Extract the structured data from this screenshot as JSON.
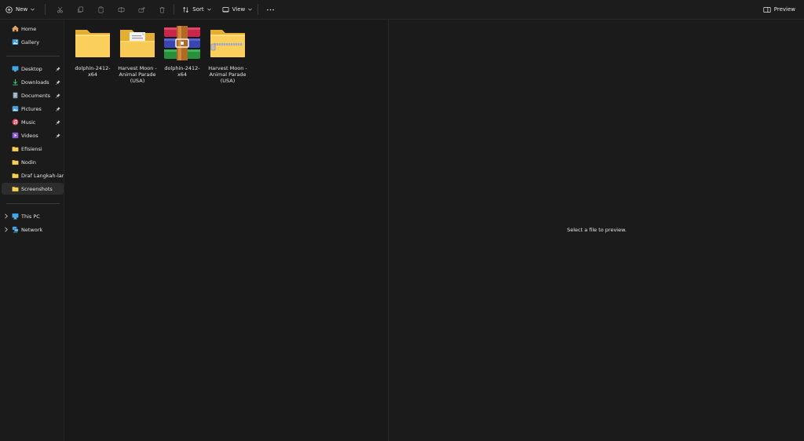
{
  "toolbar": {
    "new_label": "New",
    "sort_label": "Sort",
    "view_label": "View",
    "preview_label": "Preview"
  },
  "sidebar": {
    "items": [
      {
        "label": "Home",
        "icon": "home-icon"
      },
      {
        "label": "Gallery",
        "icon": "gallery-icon"
      },
      {
        "label": "Desktop",
        "icon": "desktop-icon",
        "pinned": true
      },
      {
        "label": "Downloads",
        "icon": "download-icon",
        "pinned": true
      },
      {
        "label": "Documents",
        "icon": "documents-icon",
        "pinned": true
      },
      {
        "label": "Pictures",
        "icon": "pictures-icon",
        "pinned": true
      },
      {
        "label": "Music",
        "icon": "music-icon",
        "pinned": true
      },
      {
        "label": "Videos",
        "icon": "videos-icon",
        "pinned": true
      },
      {
        "label": "Efisiensi",
        "icon": "folder-icon"
      },
      {
        "label": "Nodin",
        "icon": "folder-icon"
      },
      {
        "label": "Draf Langkah-langkah",
        "icon": "folder-icon"
      },
      {
        "label": "Screenshots",
        "icon": "folder-icon",
        "selected": true
      },
      {
        "label": "This PC",
        "icon": "pc-icon"
      },
      {
        "label": "Network",
        "icon": "network-icon"
      }
    ]
  },
  "files": [
    {
      "name": "dolphin-2412-x64",
      "type": "folder"
    },
    {
      "name": "Harvest Moon - Animal Parade (USA)",
      "type": "folder-with-document"
    },
    {
      "name": "dolphin-2412-x64",
      "type": "winrar-archive"
    },
    {
      "name": "Harvest Moon - Animal Parade (USA)",
      "type": "zip-folder"
    }
  ],
  "preview": {
    "message": "Select a file to preview."
  },
  "colors": {
    "background": "#191919",
    "folder_yellow": "#f8c943",
    "selected_bg": "#2d2d2d"
  }
}
